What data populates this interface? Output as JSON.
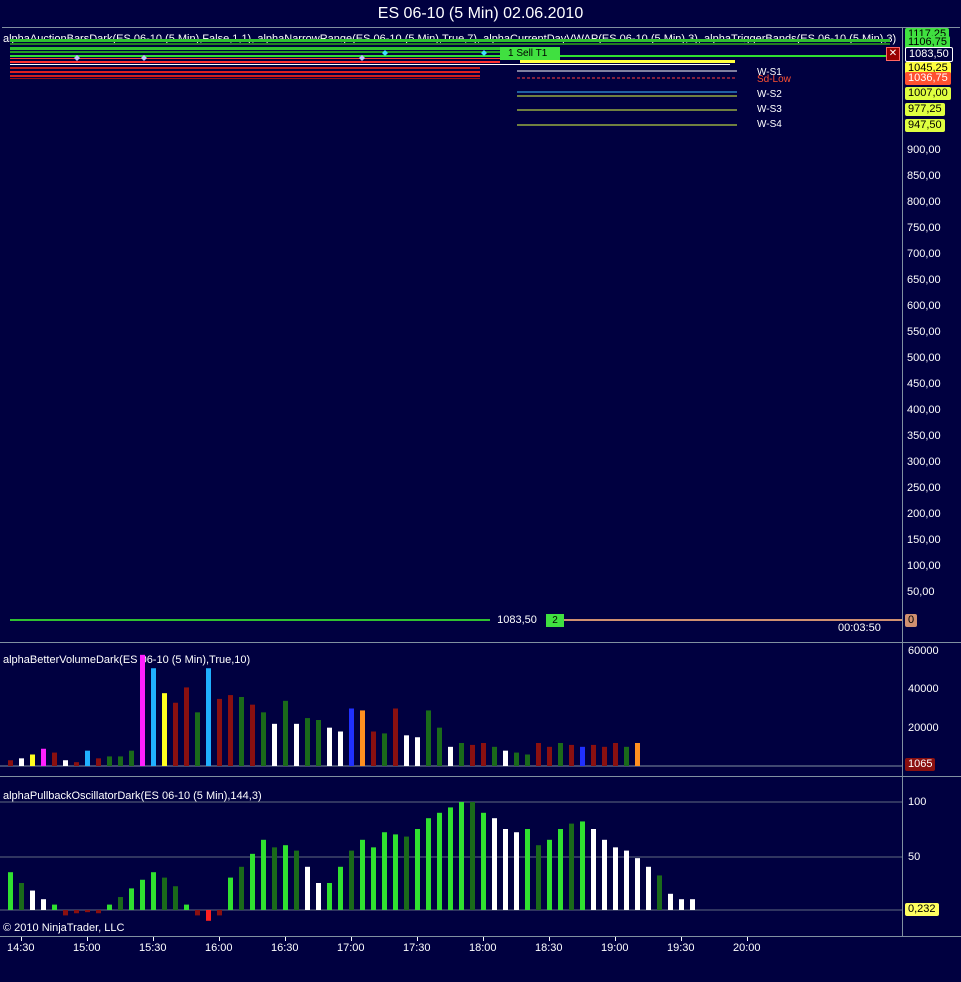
{
  "window": {
    "title": "ES 06-10 (5 Min)  02.06.2010"
  },
  "price_panel": {
    "indicator_title": "alphaAuctionBarsDark(ES 06-10 (5 Min),False,1,1), alphaNarrowRange(ES 06-10 (5 Min),True,7), alphaCurrentDayVWAP(ES 06-10 (5 Min),3), alphaTriggerBands(ES 06-10 (5 Min),3)",
    "axis_labels": [
      "900,00",
      "850,00",
      "800,00",
      "750,00",
      "700,00",
      "650,00",
      "600,00",
      "550,00",
      "500,00",
      "450,00",
      "400,00",
      "350,00",
      "300,00",
      "250,00",
      "200,00",
      "150,00",
      "100,00",
      "50,00"
    ],
    "tags": [
      {
        "text": "1117,25",
        "color": "#40e040"
      },
      {
        "text": "1106,75",
        "color": "#40e040"
      },
      {
        "text": "1083,50",
        "color": "#ffffff"
      },
      {
        "text": "1045,25",
        "color": "#ffff40"
      },
      {
        "text": "1036,75",
        "color": "#ff5030"
      },
      {
        "text": "1007,00",
        "color": "#e0ff40"
      },
      {
        "text": "977,25",
        "color": "#e0ff40"
      },
      {
        "text": "947,50",
        "color": "#e0ff40"
      }
    ],
    "level_labels": [
      "W-S1",
      "Sd-Low",
      "W-S2",
      "W-S3",
      "W-S4"
    ],
    "sell_label": "1  Sell T1",
    "last_price": "1083,50",
    "last_tag": "2",
    "zero_tag": "0",
    "clock": "00:03:50"
  },
  "volume_panel": {
    "title": "alphaBetterVolumeDark(ES 06-10 (5 Min),True,10)",
    "axis_labels": [
      "60000",
      "40000",
      "20000"
    ],
    "current_tag": "1065"
  },
  "oscillator_panel": {
    "title": "alphaPullbackOscillatorDark(ES 06-10 (5 Min),144,3)",
    "axis_labels": [
      "100",
      "50"
    ],
    "current_tag": "0,232"
  },
  "time_axis": [
    "14:30",
    "15:00",
    "15:30",
    "16:00",
    "16:30",
    "17:00",
    "17:30",
    "18:00",
    "18:30",
    "19:00",
    "19:30",
    "20:00"
  ],
  "copyright": "© 2010 NinjaTrader, LLC",
  "colors": {
    "background": "#000040",
    "green": "#30e030",
    "dark_green": "#1a6a1a",
    "dark_red": "#8a1010",
    "white": "#ffffff",
    "cyan": "#20b0ff",
    "magenta": "#ff20ff",
    "yellow": "#ffff20",
    "blue": "#2030ff",
    "orange": "#ff9020",
    "red": "#ff2020"
  },
  "chart_data": [
    {
      "type": "bar",
      "title": "alphaBetterVolumeDark(ES 06-10 (5 Min),True,10)",
      "ylim": [
        0,
        65000
      ],
      "values": [
        3000,
        4000,
        6000,
        9000,
        7000,
        3000,
        2000,
        8000,
        4000,
        5000,
        5000,
        8000,
        58000,
        51000,
        38000,
        33000,
        41000,
        28000,
        51000,
        35000,
        37000,
        36000,
        32000,
        28000,
        22000,
        34000,
        22000,
        25000,
        24000,
        20000,
        18000,
        30000,
        29000,
        18000,
        17000,
        30000,
        16000,
        15000,
        29000,
        20000,
        10000,
        12000,
        11000,
        12000,
        10000,
        8000,
        7000,
        6000,
        12000,
        10000,
        12000,
        11000,
        10000,
        11000,
        10000,
        12000,
        10000,
        12000
      ],
      "colors": [
        "dark_red",
        "white",
        "yellow",
        "magenta",
        "dark_red",
        "white",
        "dark_red",
        "cyan",
        "dark_red",
        "dark_green",
        "dark_green",
        "dark_green",
        "magenta",
        "cyan",
        "yellow",
        "dark_red",
        "dark_red",
        "dark_green",
        "cyan",
        "dark_red",
        "dark_red",
        "dark_green",
        "dark_red",
        "dark_green",
        "white",
        "dark_green",
        "white",
        "dark_green",
        "dark_green",
        "white",
        "white",
        "blue",
        "orange",
        "dark_red",
        "dark_green",
        "dark_red",
        "white",
        "white",
        "dark_green",
        "dark_green",
        "white",
        "dark_green",
        "dark_red",
        "dark_red",
        "dark_green",
        "white",
        "dark_green",
        "dark_green",
        "dark_red",
        "dark_red",
        "dark_green",
        "dark_red",
        "blue",
        "dark_red",
        "dark_red",
        "dark_red",
        "dark_green",
        "orange",
        "dark_red",
        "cyan",
        "yellow"
      ]
    },
    {
      "type": "bar",
      "title": "alphaPullbackOscillatorDark(ES 06-10 (5 Min),144,3)",
      "ylim": [
        -20,
        120
      ],
      "values": [
        35,
        25,
        18,
        10,
        5,
        -5,
        -3,
        -2,
        -3,
        5,
        12,
        20,
        28,
        35,
        30,
        22,
        5,
        -5,
        -10,
        -5,
        30,
        40,
        52,
        65,
        58,
        60,
        55,
        40,
        25,
        25,
        40,
        55,
        65,
        58,
        72,
        70,
        68,
        75,
        85,
        90,
        95,
        100,
        100,
        90,
        85,
        75,
        72,
        75,
        60,
        65,
        75,
        80,
        82,
        75,
        65,
        58,
        55,
        48,
        40,
        32,
        15,
        10,
        10
      ],
      "colors": [
        "green",
        "dark_green",
        "white",
        "white",
        "green",
        "dark_red",
        "dark_red",
        "dark_red",
        "dark_red",
        "green",
        "dark_green",
        "green",
        "green",
        "green",
        "dark_green",
        "dark_green",
        "green",
        "dark_red",
        "red",
        "dark_red",
        "green",
        "dark_green",
        "green",
        "green",
        "dark_green",
        "green",
        "dark_green",
        "white",
        "white",
        "green",
        "green",
        "dark_green",
        "green",
        "green",
        "green",
        "green",
        "dark_green",
        "green",
        "green",
        "green",
        "green",
        "green",
        "dark_green",
        "green",
        "white",
        "white",
        "white",
        "green",
        "dark_green",
        "green",
        "green",
        "dark_green",
        "green",
        "white",
        "white",
        "white",
        "white",
        "white",
        "white",
        "dark_green",
        "white",
        "white",
        "white"
      ]
    }
  ]
}
